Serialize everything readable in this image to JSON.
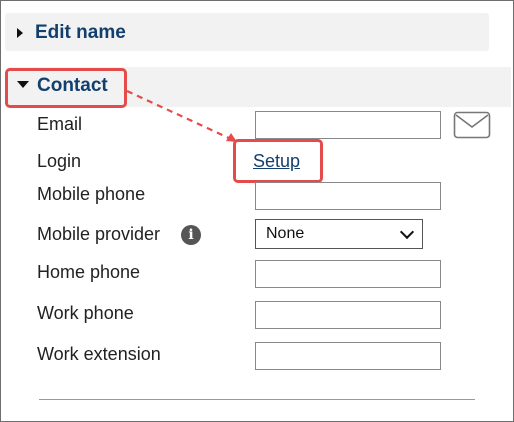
{
  "sections": {
    "edit_name": {
      "label": "Edit name"
    },
    "contact": {
      "label": "Contact"
    }
  },
  "fields": {
    "email": {
      "label": "Email",
      "value": ""
    },
    "login": {
      "label": "Login",
      "link_text": "Setup"
    },
    "mobile_phone": {
      "label": "Mobile phone",
      "value": ""
    },
    "mobile_provider": {
      "label": "Mobile provider",
      "selected": "None"
    },
    "home_phone": {
      "label": "Home phone",
      "value": ""
    },
    "work_phone": {
      "label": "Work phone",
      "value": ""
    },
    "work_extension": {
      "label": "Work extension",
      "value": ""
    }
  },
  "icons": {
    "info": "i",
    "mail": "envelope-icon"
  },
  "colors": {
    "highlight": "#e44b4b",
    "link": "#123f6e",
    "header_bg": "#f2f2f2"
  }
}
